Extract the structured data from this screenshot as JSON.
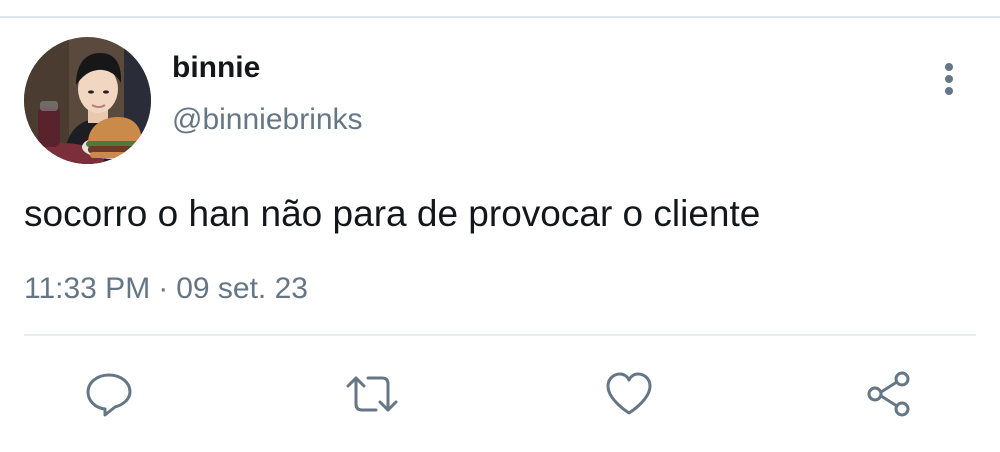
{
  "tweet": {
    "display_name": "binnie",
    "handle": "@binniebrinks",
    "text": "socorro o han não para de provocar o cliente",
    "time": "11:33 PM",
    "separator": "·",
    "date": "09 set. 23"
  },
  "icons": {
    "more": "more-vertical-icon",
    "reply": "reply-icon",
    "retweet": "retweet-icon",
    "like": "heart-icon",
    "share": "share-icon"
  },
  "colors": {
    "text": "#14171a",
    "secondary": "#657786",
    "icon": "#657786",
    "divider": "#e6ecf0"
  }
}
